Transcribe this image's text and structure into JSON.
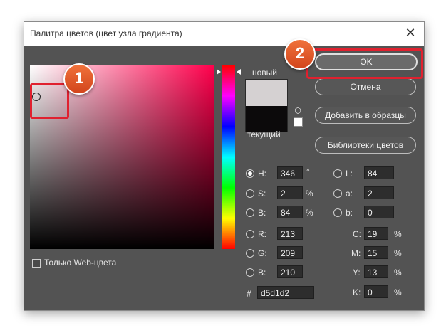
{
  "window": {
    "title": "Палитра цветов (цвет узла градиента)"
  },
  "labels": {
    "new": "новый",
    "current": "текущий",
    "web_only": "Только Web-цвета"
  },
  "buttons": {
    "ok": "OK",
    "cancel": "Отмена",
    "add_swatches": "Добавить в образцы",
    "libraries": "Библиотеки цветов"
  },
  "colors": {
    "new": "#d5d1d2",
    "current": "#0c0a0b",
    "highlight": "#e0212f",
    "badge": "#e2592a"
  },
  "fields": {
    "H": {
      "label": "H:",
      "value": "346",
      "unit": "°"
    },
    "S": {
      "label": "S:",
      "value": "2",
      "unit": "%"
    },
    "Bv": {
      "label": "B:",
      "value": "84",
      "unit": "%"
    },
    "R": {
      "label": "R:",
      "value": "213"
    },
    "G": {
      "label": "G:",
      "value": "209"
    },
    "B2": {
      "label": "B:",
      "value": "210"
    },
    "L": {
      "label": "L:",
      "value": "84"
    },
    "a": {
      "label": "a:",
      "value": "2"
    },
    "b": {
      "label": "b:",
      "value": "0"
    },
    "C": {
      "label": "C:",
      "value": "19",
      "unit": "%"
    },
    "M": {
      "label": "M:",
      "value": "15",
      "unit": "%"
    },
    "Y": {
      "label": "Y:",
      "value": "13",
      "unit": "%"
    },
    "K": {
      "label": "K:",
      "value": "0",
      "unit": "%"
    },
    "hex": {
      "label": "#",
      "value": "d5d1d2"
    }
  },
  "annotations": {
    "one": "1",
    "two": "2"
  }
}
